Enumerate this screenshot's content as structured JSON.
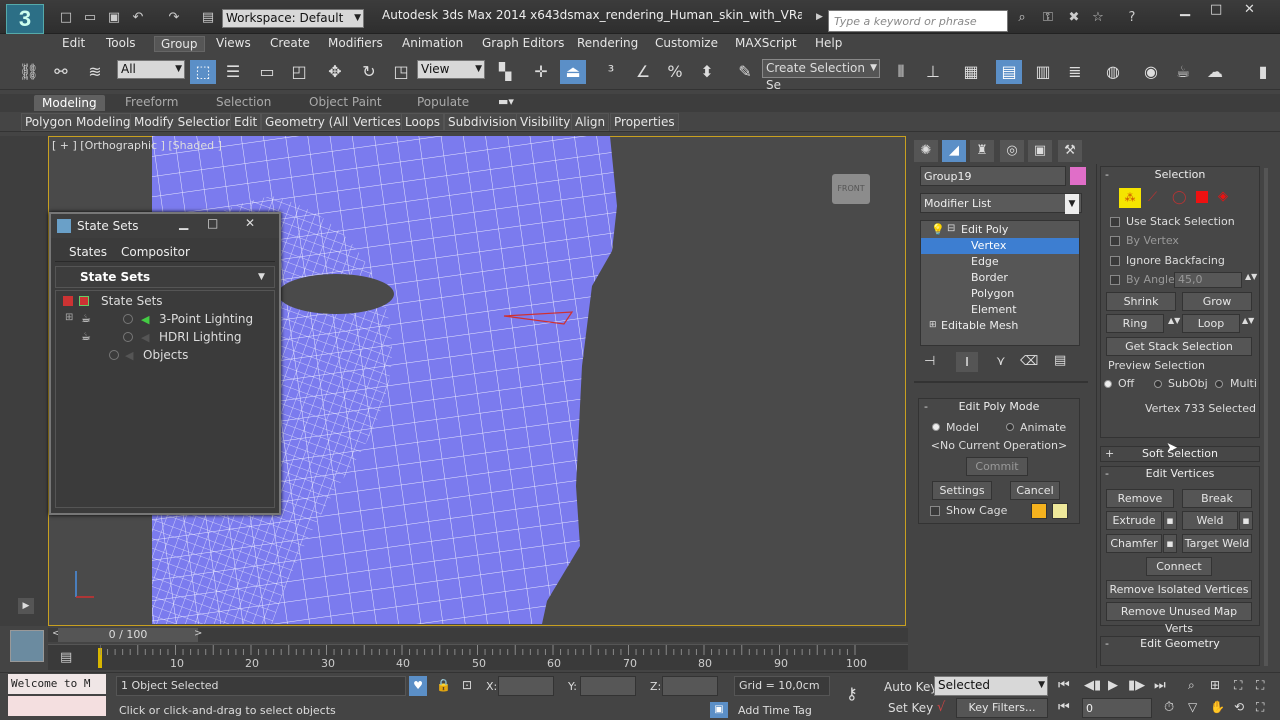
{
  "window": {
    "logo": "3",
    "workspace": "Workspace: Default",
    "app_title": "Autodesk 3ds Max  2014 x64",
    "file_title": "3dsmax_rendering_Human_skin_with_VRay.m...",
    "search_placeholder": "Type a keyword or phrase"
  },
  "menu": [
    "Edit",
    "Tools",
    "Group",
    "Views",
    "Create",
    "Modifiers",
    "Animation",
    "Graph Editors",
    "Rendering",
    "Customize",
    "MAXScript",
    "Help"
  ],
  "toolbar": {
    "filter": "All",
    "ref_coord": "View",
    "selection_set": "Create Selection Se"
  },
  "ribbon": {
    "tabs": [
      "Modeling",
      "Freeform",
      "Selection",
      "Object Paint",
      "Populate"
    ],
    "panels": [
      "Polygon Modeling",
      "Modify Selection",
      "Edit",
      "Geometry (All)",
      "Vertices",
      "Loops",
      "Subdivision",
      "Visibility",
      "Align",
      "Properties"
    ]
  },
  "viewport": {
    "label": "[ + ] [Orthographic ] [Shaded ]",
    "viewcube": "FRONT"
  },
  "state_sets": {
    "title": "State Sets",
    "menu": [
      "States",
      "Compositor"
    ],
    "panel": "State Sets",
    "tree": [
      "State Sets",
      "3-Point Lighting",
      "HDRI Lighting",
      "Objects"
    ]
  },
  "command_panel": {
    "object_name": "Group19",
    "modifier_list": "Modifier List",
    "stack": [
      "Edit Poly",
      "Vertex",
      "Edge",
      "Border",
      "Polygon",
      "Element",
      "Editable Mesh"
    ],
    "edit_poly_mode": {
      "title": "Edit Poly Mode",
      "model": "Model",
      "animate": "Animate",
      "operation": "<No Current Operation>",
      "commit": "Commit",
      "settings": "Settings",
      "cancel": "Cancel",
      "show_cage": "Show Cage",
      "cage_colors": [
        "#f5b21e",
        "#eee89a"
      ]
    }
  },
  "selection_rollout": {
    "title": "Selection",
    "use_stack": "Use Stack Selection",
    "by_vertex": "By Vertex",
    "ignore_backfacing": "Ignore Backfacing",
    "by_angle": "By Angle:",
    "angle_value": "45,0",
    "shrink": "Shrink",
    "grow": "Grow",
    "ring": "Ring",
    "loop": "Loop",
    "get_stack": "Get Stack Selection",
    "preview_title": "Preview Selection",
    "preview_off": "Off",
    "preview_subobj": "SubObj",
    "preview_multi": "Multi",
    "status": "Vertex 733 Selected"
  },
  "soft_selection": "Soft Selection",
  "edit_vertices": {
    "title": "Edit Vertices",
    "remove": "Remove",
    "break": "Break",
    "extrude": "Extrude",
    "weld": "Weld",
    "chamfer": "Chamfer",
    "target_weld": "Target Weld",
    "connect": "Connect",
    "remove_isolated": "Remove Isolated Vertices",
    "remove_unused": "Remove Unused Map Verts"
  },
  "edit_geometry": "Edit Geometry",
  "timeline": {
    "position": "0 / 100",
    "ticks": [
      "10",
      "20",
      "30",
      "40",
      "50",
      "60",
      "70",
      "80",
      "90",
      "100"
    ]
  },
  "status": {
    "listener": "Welcome to M",
    "objects_selected": "1 Object Selected",
    "prompt": "Click or click-and-drag to select objects",
    "x_label": "X:",
    "y_label": "Y:",
    "z_label": "Z:",
    "grid": "Grid = 10,0cm",
    "add_time_tag": "Add Time Tag",
    "auto_key": "Auto Key",
    "set_key": "Set Key",
    "key_mode": "Selected",
    "key_filters": "Key Filters...",
    "frame": "0"
  }
}
